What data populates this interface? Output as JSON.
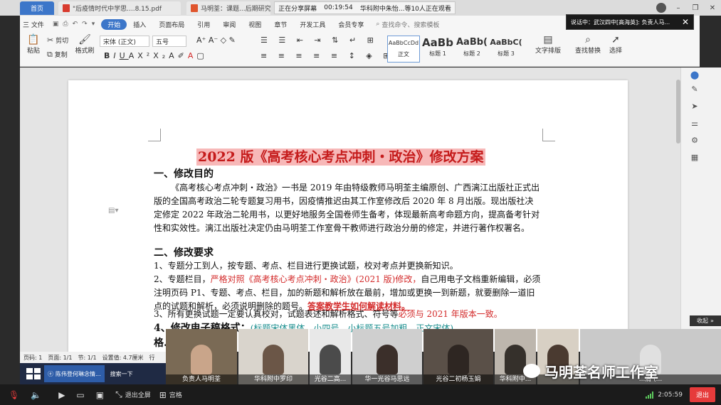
{
  "tabs": [
    {
      "label": "首页"
    },
    {
      "label": "\"后疫情时代中学思....8.15.pdf"
    },
    {
      "label": "马明荃：课题...后期研究题"
    }
  ],
  "share_banner": {
    "status": "正在分享屏幕",
    "timer": "00:19:54",
    "participants": "华科附中朱怡...等10人正在观看"
  },
  "ribbon": {
    "file_menu": "三 文件",
    "menus": [
      "开始",
      "插入",
      "页面布局",
      "引用",
      "审阅",
      "视图",
      "章节",
      "开发工具",
      "会员专享"
    ],
    "search_placeholder": "查找命令、搜索模板",
    "paste": "粘贴",
    "cut": "剪切",
    "copy": "复制",
    "format_painter": "格式刷",
    "font_name": "宋体 (正文)",
    "font_size": "五号",
    "styles": [
      {
        "sample": "AaBbCcDd",
        "label": "正文"
      },
      {
        "sample": "AaBb",
        "label": "标题 1"
      },
      {
        "sample": "AaBb(",
        "label": "标题 2"
      },
      {
        "sample": "AaBbC(",
        "label": "标题 3"
      }
    ],
    "text_layout": "文字排版",
    "find_replace": "查找替换",
    "select": "选择"
  },
  "speaker_note": "说话中：武汉四中[高海英]: 负责人马...",
  "document": {
    "title": "2022 版《高考核心考点冲刺・政治》修改方案",
    "h1": "一、修改目的",
    "p1": "《高考核心考点冲刺・政治》一书是 2019 年由特级教师马明荃主编原创、广西漓江出版社正式出版的全国高考政治二轮专题复习用书，因疫情推迟由其工作室修改后 2020 年 8 月出版。现出版社决定修定 2022 年政治二轮用书，以更好地服务全国卷师生备考，体现最新高考命题方向，提高备考针对性和实效性。漓江出版社决定仍由马明荃工作室骨干教师进行政治分册的修定，并进行著作权署名。",
    "h2": "二、修改要求",
    "p2": "1、专题分工到人，按专题、考点、栏目进行更换试题，校对考点并更换新知识。",
    "p3_a": "2、专题栏目，",
    "p3_red": "严格对照《高考核心考点冲刺・政治》(2021 版)修改，",
    "p3_b": "自己用电子文档重新编辑，必须注明页码 P1、专题、考点、栏目，加的新题和解析放在最前，增加或更换一到新题，就要删除一道旧点的试题和解析，必须说明删除的题号。",
    "p3_link": "答案教学生如何解读材料。",
    "p4_a": "3、所有更换试题一定要认真校对，试题表述和解析格式、符号等",
    "p4_red": "必须与 2021 年版本一致。",
    "h3": "4、修改电子稿格式：",
    "h3_note": "(标题宋体黑体，小四号，小标题五号加粗，正文宋体)",
    "h4": "格..."
  },
  "status_bar": {
    "page": "页码: 1",
    "pages": "页面: 1/1",
    "section": "节: 1/1",
    "setting": "设置值: 4.7厘米",
    "row": "行"
  },
  "collapse_label": "收起",
  "taskbar": {
    "item1": "陈伟登何琳念情...",
    "item2": "搜索一下"
  },
  "video_tiles": [
    {
      "name": "负责人马明荃"
    },
    {
      "name": "华科附中罗印"
    },
    {
      "name": "光谷二高..."
    },
    {
      "name": "华一光谷马思远"
    },
    {
      "name": "光谷二初杨玉娟"
    },
    {
      "name": "华科附中..."
    },
    {
      "name": ""
    },
    {
      "name": "...清 (..."
    }
  ],
  "watermark": "马明荃名师工作室",
  "meeting_bar": {
    "exit_fullscreen": "退出全屏",
    "grid": "宫格",
    "time": "2:05:59",
    "exit": "退出"
  },
  "colors": {
    "accent": "#3c76c9",
    "title_red": "#c51b1b",
    "highlight": "#f7b8b8",
    "exit": "#e63b3b"
  }
}
